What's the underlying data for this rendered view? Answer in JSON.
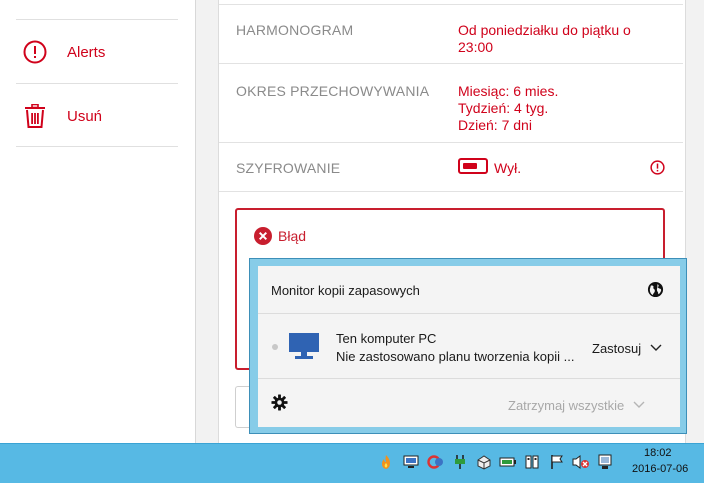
{
  "sidebar": {
    "items": [
      {
        "label": "Alerts",
        "icon": "alert-circle-icon"
      },
      {
        "label": "Usuń",
        "icon": "trash-icon"
      }
    ]
  },
  "settings": {
    "schedule": {
      "label": "HARMONOGRAM",
      "value_line1": "Od poniedziałku do piątku o",
      "value_line2": "23:00"
    },
    "retention": {
      "label": "OKRES PRZECHOWYWANIA",
      "monthly": "Miesiąc: 6 mies.",
      "weekly": "Tydzień: 4 tyg.",
      "daily": "Dzień: 7 dni"
    },
    "encryption": {
      "label": "SZYFROWANIE",
      "state": "Wył.",
      "enabled": false
    }
  },
  "error": {
    "title": "Błąd"
  },
  "popup": {
    "title": "Monitor kopii zapasowych",
    "computer_name": "Ten komputer PC",
    "computer_status": "Nie zastosowano planu tworzenia kopii ...",
    "apply_label": "Zastosuj",
    "pause_all_label": "Zatrzymaj wszystkie"
  },
  "taskbar": {
    "time": "18:02",
    "date": "2016-07-06"
  },
  "colors": {
    "accent": "#d0021b",
    "taskbar": "#57b9e4",
    "popup_border": "#87cce8"
  }
}
